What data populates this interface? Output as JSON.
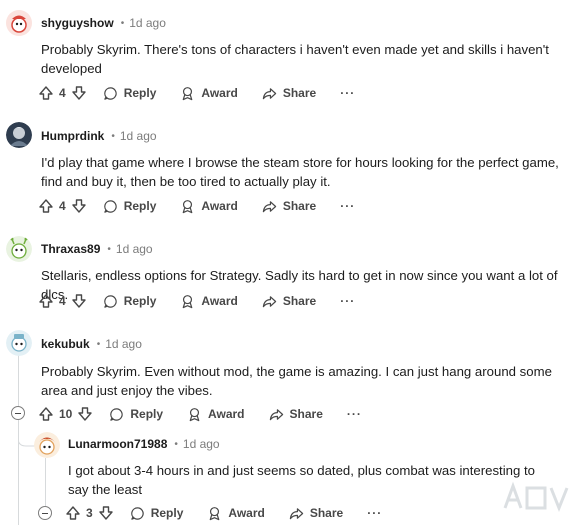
{
  "comments": [
    {
      "author": "shyguyshow",
      "time": "1d ago",
      "body": "Probably Skyrim. There's tons of characters i haven't even made yet and skills i haven't developed",
      "votes": "4",
      "reply": "Reply",
      "award": "Award",
      "share": "Share",
      "more": "···",
      "avatar_color": "#d9463b"
    },
    {
      "author": "Humprdink",
      "time": "1d ago",
      "body": "I'd play that game where I browse the steam store for hours looking for the perfect game, find and buy it, then be too tired to actually play it.",
      "votes": "4",
      "reply": "Reply",
      "award": "Award",
      "share": "Share",
      "more": "···",
      "avatar_color": "#3a4a5c"
    },
    {
      "author": "Thraxas89",
      "time": "1d ago",
      "body": "Stellaris, endless options for Strategy. Sadly its hard to get in now since you want a lot of dlcs.",
      "votes": "4",
      "reply": "Reply",
      "award": "Award",
      "share": "Share",
      "more": "···",
      "avatar_color": "#6fae3c"
    },
    {
      "author": "kekubuk",
      "time": "1d ago",
      "body": "Probably Skyrim. Even without mod, the game is amazing. I can just hang around some area and just enjoy the vibes.",
      "votes": "10",
      "reply": "Reply",
      "award": "Award",
      "share": "Share",
      "more": "···",
      "avatar_color": "#7ab3c9"
    },
    {
      "author": "Lunarmoon71988",
      "time": "1d ago",
      "body": "I got about 3-4 hours in and just seems so dated, plus combat was interesting to say the least",
      "votes": "3",
      "reply": "Reply",
      "award": "Award",
      "share": "Share",
      "more": "···",
      "avatar_color": "#e2a25d"
    }
  ],
  "dot": "•",
  "colors": {
    "text": "#1c1c1c",
    "muted": "#7c7c7c",
    "action": "#484848",
    "thread": "#d7dadc"
  }
}
